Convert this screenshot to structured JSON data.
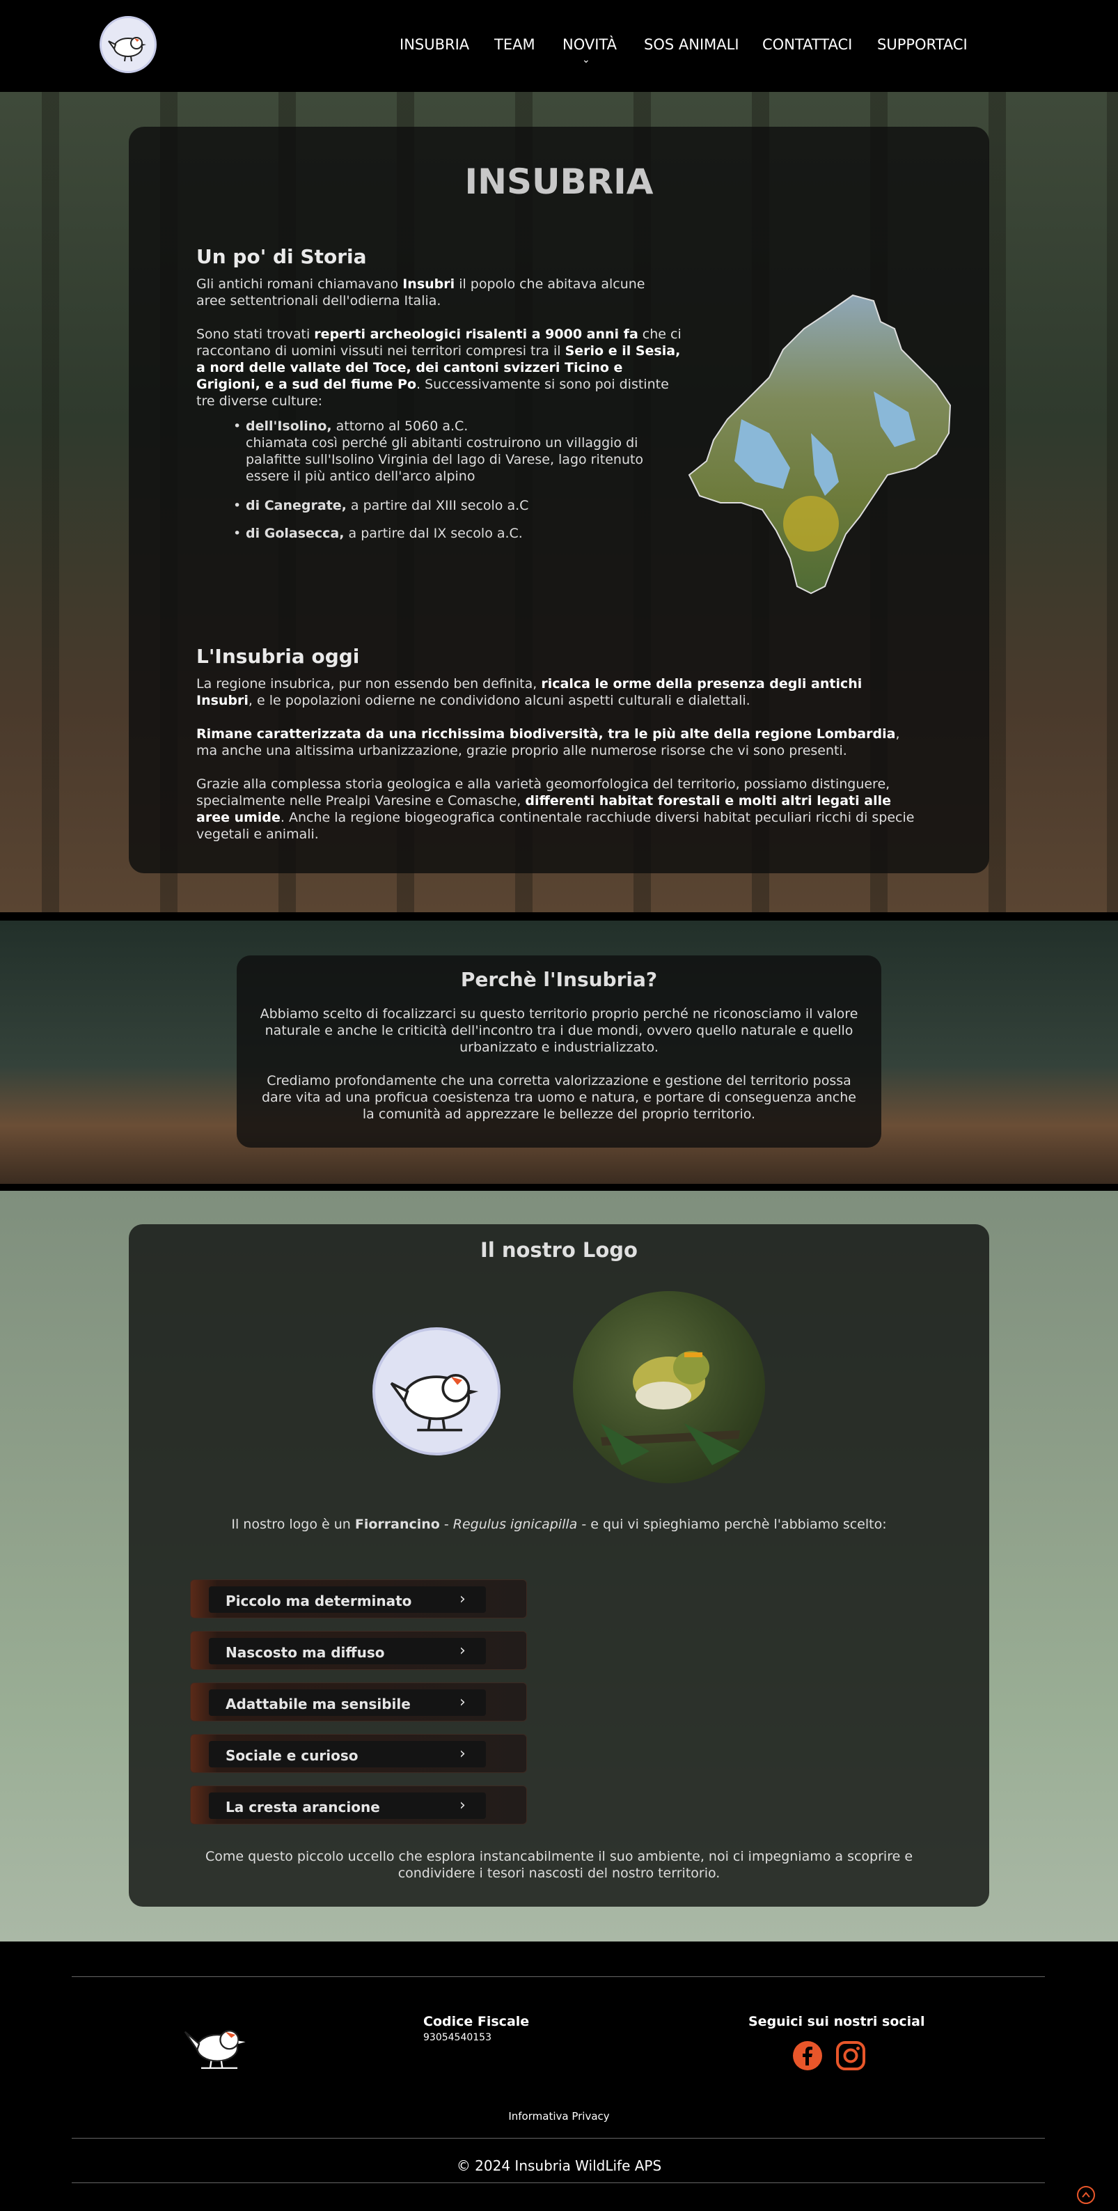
{
  "header": {
    "nav": [
      {
        "label": "INSUBRIA"
      },
      {
        "label": "TEAM"
      },
      {
        "label": "NOVITÀ"
      },
      {
        "label": "SOS ANIMALI"
      },
      {
        "label": "CONTATTACI"
      },
      {
        "label": "SUPPORTACI"
      }
    ],
    "chevron_icon": "chevron-down-icon"
  },
  "insubria": {
    "title": "INSUBRIA",
    "storia_title": "Un po' di Storia",
    "storia_p1": [
      "Gli antichi romani chiamavano ",
      "Insubri",
      " il popolo che abitava alcune aree settentrionali dell'odierna Italia."
    ],
    "storia_p2": [
      "Sono stati trovati ",
      "reperti archeologici risalenti a 9000 anni fa",
      " che ci raccontano di uomini vissuti nei territori compresi tra il ",
      "Serio e il Sesia, a nord delle vallate del Toce, dei cantoni svizzeri Ticino e Grigioni, e a sud del fiume Po",
      ". Successivamente si sono poi distinte tre diverse culture:"
    ],
    "cultures": [
      {
        "bold": "dell'Isolino,",
        "text": " attorno al 5060 a.C.",
        "sub": "chiamata così perché gli abitanti costruirono un villaggio di palafitte sull'Isolino Virginia del lago di Varese, lago ritenuto essere il più antico dell'arco alpino"
      },
      {
        "bold": "di Canegrate,",
        "text": " a partire dal XIII secolo a.C",
        "sub": ""
      },
      {
        "bold": "di Golasecca,",
        "text": " a partire dal IX secolo a.C.",
        "sub": ""
      }
    ],
    "oggi_title": "L'Insubria oggi",
    "oggi_p1": [
      "La regione insubrica, pur non essendo ben definita, ",
      "ricalca le orme della presenza degli antichi Insubri",
      ", e le popolazioni odierne ne condividono alcuni aspetti culturali e dialettali."
    ],
    "oggi_p2": [
      "Rimane caratterizzata da una ricchissima biodiversità, tra le più alte della regione Lombardia",
      ", ma anche una altissima urbanizzazione, grazie proprio alle numerose risorse che vi sono presenti."
    ],
    "oggi_p3": [
      "Grazie alla complessa storia geologica e alla varietà geomorfologica del territorio, possiamo distinguere, specialmente nelle Prealpi Varesine e Comasche, ",
      "differenti habitat forestali e molti altri legati alle aree umide",
      ". Anche la regione biogeografica continentale racchiude diversi habitat peculiari ricchi di specie vegetali e animali."
    ]
  },
  "perche": {
    "title": "Perchè l'Insubria?",
    "p1": "Abbiamo scelto di focalizzarci su questo territorio proprio perché ne riconosciamo il valore naturale e anche le criticità dell'incontro tra i due mondi, ovvero quello naturale e quello urbanizzato e industrializzato.",
    "p2": "Crediamo profondamente che una corretta valorizzazione e gestione del territorio possa dare vita ad una proficua coesistenza tra uomo e natura, e portare di conseguenza anche la comunità ad apprezzare le bellezze del proprio territorio."
  },
  "logo_section": {
    "title": "Il nostro Logo",
    "intro": [
      "Il nostro logo è un ",
      "Fiorrancino",
      " - ",
      "Regulus ignicapilla",
      " - e qui vi spieghiamo perchè l'abbiamo scelto:"
    ],
    "accordion": [
      {
        "label": "Piccolo ma determinato"
      },
      {
        "label": "Nascosto ma diffuso"
      },
      {
        "label": "Adattabile ma sensibile"
      },
      {
        "label": "Sociale e curioso"
      },
      {
        "label": "La cresta arancione"
      }
    ],
    "closing": "Come questo piccolo uccello che esplora instancabilmente il suo ambiente, noi ci impegniamo a scoprire e condividere i tesori nascosti del nostro territorio."
  },
  "footer": {
    "cf_title": "Codice Fiscale",
    "cf_value": "93054540153",
    "social_title": "Seguici sui nostri social",
    "social_icons": [
      "facebook-icon",
      "instagram-icon"
    ],
    "privacy": "Informativa Privacy",
    "copyright": "© 2024 Insubria WildLife APS"
  },
  "colors": {
    "accent": "#e8562a",
    "card_bg": "#111111"
  }
}
